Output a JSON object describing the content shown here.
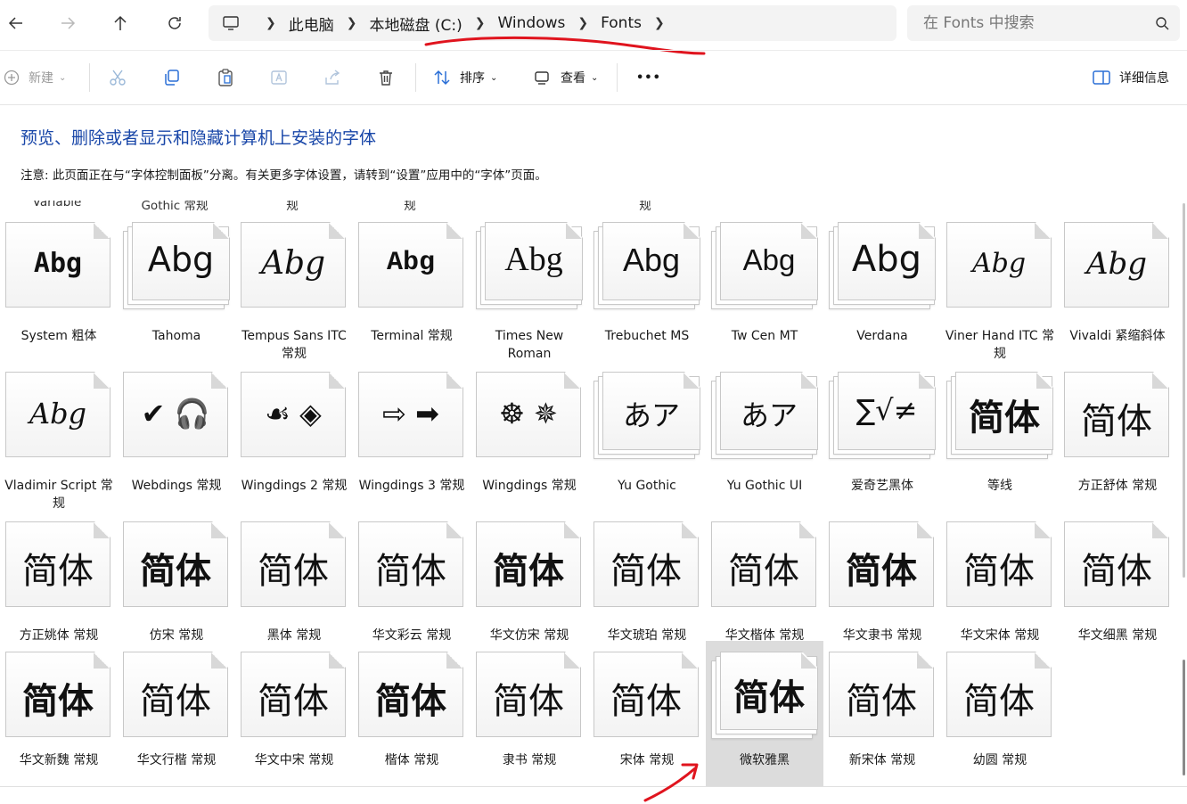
{
  "addressbar": {
    "breadcrumb": [
      "此电脑",
      "本地磁盘 (C:)",
      "Windows",
      "Fonts"
    ],
    "search_placeholder": "在 Fonts 中搜索"
  },
  "toolbar": {
    "new_label": "新建",
    "sort_label": "排序",
    "view_label": "查看",
    "more_label": "•••",
    "details_label": "详细信息"
  },
  "page": {
    "heading": "预览、删除或者显示和隐藏计算机上安装的字体",
    "note": "注意: 此页面正在与“字体控制面板”分离。有关更多字体设置，请转到“设置”应用中的“字体”页面。"
  },
  "partial_labels": [
    "Variable",
    "Gothic 常规",
    "规",
    "规",
    "规"
  ],
  "fonts": [
    {
      "name": "System 粗体",
      "sample": "Abg",
      "stack": false
    },
    {
      "name": "Tahoma",
      "sample": "Abg",
      "stack": true
    },
    {
      "name": "Tempus Sans ITC 常规",
      "sample": "Abg",
      "stack": false
    },
    {
      "name": "Terminal 常规",
      "sample": "Abg",
      "stack": false
    },
    {
      "name": "Times New Roman",
      "sample": "Abg",
      "stack": true
    },
    {
      "name": "Trebuchet MS",
      "sample": "Abg",
      "stack": true
    },
    {
      "name": "Tw Cen MT",
      "sample": "Abg",
      "stack": true
    },
    {
      "name": "Verdana",
      "sample": "Abg",
      "stack": true
    },
    {
      "name": "Viner Hand ITC 常规",
      "sample": "Abg",
      "stack": false
    },
    {
      "name": "Vivaldi 紧缩斜体",
      "sample": "Abg",
      "stack": false
    },
    {
      "name": "Vladimir Script 常规",
      "sample": "Abg",
      "stack": false
    },
    {
      "name": "Webdings 常规",
      "sample": "✔ 🎧",
      "stack": false
    },
    {
      "name": "Wingdings 2 常规",
      "sample": "☙ ◈",
      "stack": false
    },
    {
      "name": "Wingdings 3 常规",
      "sample": "⇨ ➡",
      "stack": false
    },
    {
      "name": "Wingdings 常规",
      "sample": "☸ ✵",
      "stack": false
    },
    {
      "name": "Yu Gothic",
      "sample": "あア",
      "stack": true
    },
    {
      "name": "Yu Gothic UI",
      "sample": "あア",
      "stack": true
    },
    {
      "name": "爱奇艺黑体",
      "sample": "∑√≠",
      "stack": true
    },
    {
      "name": "等线",
      "sample": "简体",
      "stack": true
    },
    {
      "name": "方正舒体 常规",
      "sample": "简体",
      "stack": false
    },
    {
      "name": "方正姚体 常规",
      "sample": "简体",
      "stack": false
    },
    {
      "name": "仿宋 常规",
      "sample": "简体",
      "stack": false
    },
    {
      "name": "黑体 常规",
      "sample": "简体",
      "stack": false
    },
    {
      "name": "华文彩云 常规",
      "sample": "简体",
      "stack": false
    },
    {
      "name": "华文仿宋 常规",
      "sample": "简体",
      "stack": false
    },
    {
      "name": "华文琥珀 常规",
      "sample": "简体",
      "stack": false
    },
    {
      "name": "华文楷体 常规",
      "sample": "简体",
      "stack": false
    },
    {
      "name": "华文隶书 常规",
      "sample": "简体",
      "stack": false
    },
    {
      "name": "华文宋体 常规",
      "sample": "简体",
      "stack": false
    },
    {
      "name": "华文细黑 常规",
      "sample": "简体",
      "stack": false
    },
    {
      "name": "华文新魏 常规",
      "sample": "简体",
      "stack": false
    },
    {
      "name": "华文行楷 常规",
      "sample": "简体",
      "stack": false
    },
    {
      "name": "华文中宋 常规",
      "sample": "简体",
      "stack": false
    },
    {
      "name": "楷体 常规",
      "sample": "简体",
      "stack": false
    },
    {
      "name": "隶书 常规",
      "sample": "简体",
      "stack": false
    },
    {
      "name": "宋体 常规",
      "sample": "简体",
      "stack": false
    },
    {
      "name": "微软雅黑",
      "sample": "简体",
      "stack": true,
      "selected": true
    },
    {
      "name": "新宋体 常规",
      "sample": "简体",
      "stack": false
    },
    {
      "name": "幼圆 常规",
      "sample": "简体",
      "stack": false
    }
  ],
  "colors": {
    "accent": "#1846a8",
    "annotation": "#e0141e",
    "selected": "#dcdcdc"
  }
}
